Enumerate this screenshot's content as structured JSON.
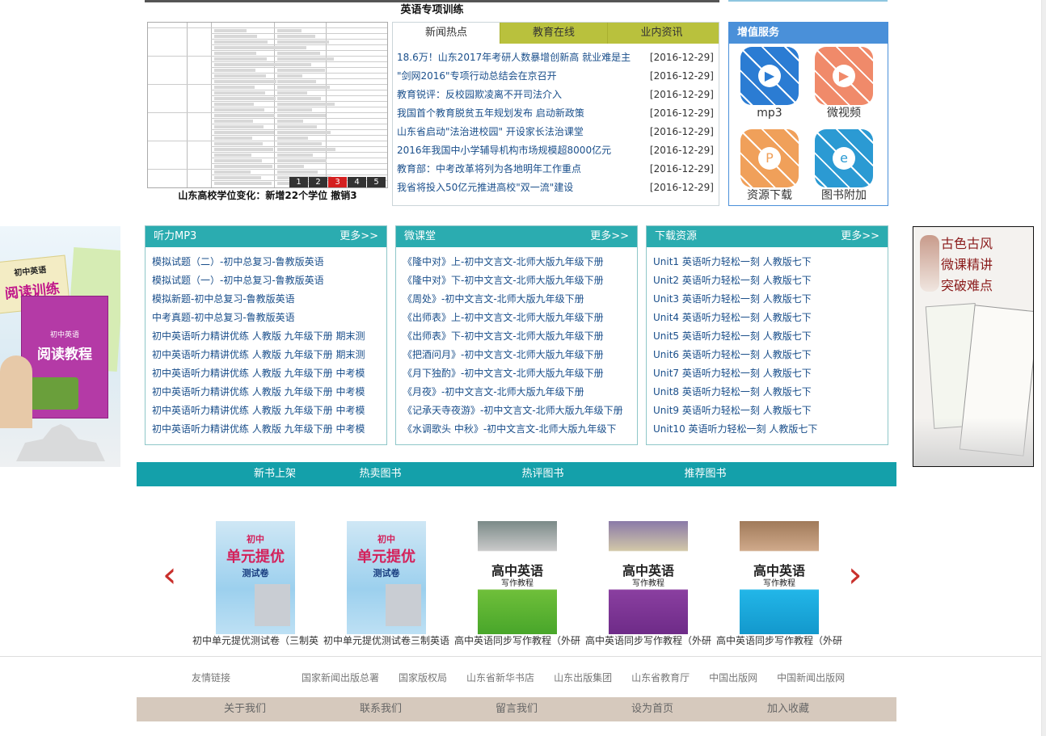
{
  "top_banner": {
    "title": "英语专项训练"
  },
  "slideshow": {
    "caption": "山东高校学位变化：新增22个学位  撤销3",
    "pages": [
      "1",
      "2",
      "3",
      "4",
      "5"
    ],
    "active_page": 3
  },
  "news": {
    "tabs": [
      "新闻热点",
      "教育在线",
      "业内资讯"
    ],
    "items": [
      {
        "title": "18.6万！山东2017年考研人数暴增创新高 就业难是主",
        "date": "[2016-12-29]"
      },
      {
        "title": "\"剑网2016\"专项行动总结会在京召开",
        "date": "[2016-12-29]"
      },
      {
        "title": "教育锐评：反校园欺凌离不开司法介入",
        "date": "[2016-12-29]"
      },
      {
        "title": "我国首个教育脱贫五年规划发布 启动新政策",
        "date": "[2016-12-29]"
      },
      {
        "title": "山东省启动\"法治进校园\" 开设家长法治课堂",
        "date": "[2016-12-29]"
      },
      {
        "title": "2016年我国中小学辅导机构市场规模超8000亿元",
        "date": "[2016-12-29]"
      },
      {
        "title": "教育部：中考改革将列为各地明年工作重点",
        "date": "[2016-12-29]"
      },
      {
        "title": "我省将投入50亿元推进高校\"双一流\"建设",
        "date": "[2016-12-29]"
      }
    ]
  },
  "services": {
    "title": "增值服务",
    "items": [
      {
        "label": "mp3",
        "icon": "play-icon",
        "color": "#2b7cd3"
      },
      {
        "label": "微视频",
        "icon": "video-icon",
        "color": "#f08a6a"
      },
      {
        "label": "资源下载",
        "icon": "ppt-icon",
        "color": "#f0a05a"
      },
      {
        "label": "图书附加",
        "icon": "ie-icon",
        "color": "#2b9ad3"
      }
    ]
  },
  "ads": {
    "left": {
      "line1": "初中英语",
      "line2": "阅读训练",
      "line3": "阅读教程",
      "line4": "初中英语"
    },
    "right": {
      "line1": "古色古风",
      "line2": "微课精讲",
      "line3": "突破难点"
    }
  },
  "panels": [
    {
      "title": "听力MP3",
      "more": "更多>>",
      "items": [
        "模拟试题（二）-初中总复习-鲁教版英语",
        "模拟试题（一）-初中总复习-鲁教版英语",
        "模拟新题-初中总复习-鲁教版英语",
        "中考真题-初中总复习-鲁教版英语",
        "初中英语听力精讲优练 人教版 九年级下册 期末测",
        "初中英语听力精讲优练 人教版 九年级下册 期末测",
        "初中英语听力精讲优练 人教版 九年级下册 中考模",
        "初中英语听力精讲优练 人教版 九年级下册 中考模",
        "初中英语听力精讲优练 人教版 九年级下册 中考模",
        "初中英语听力精讲优练 人教版 九年级下册 中考模"
      ]
    },
    {
      "title": "微课堂",
      "more": "更多>>",
      "items": [
        "《隆中对》上-初中文言文-北师大版九年级下册",
        "《隆中对》下-初中文言文-北师大版九年级下册",
        "《周处》-初中文言文-北师大版九年级下册",
        "《出师表》上-初中文言文-北师大版九年级下册",
        "《出师表》下-初中文言文-北师大版九年级下册",
        "《把酒问月》-初中文言文-北师大版九年级下册",
        "《月下独酌》-初中文言文-北师大版九年级下册",
        "《月夜》-初中文言文-北师大版九年级下册",
        "《记承天寺夜游》-初中文言文-北师大版九年级下册",
        "《水调歌头 中秋》-初中文言文-北师大版九年级下"
      ]
    },
    {
      "title": "下载资源",
      "more": "更多>>",
      "items": [
        "Unit1 英语听力轻松一刻 人教版七下",
        "Unit2 英语听力轻松一刻 人教版七下",
        "Unit3 英语听力轻松一刻 人教版七下",
        "Unit4 英语听力轻松一刻 人教版七下",
        "Unit5 英语听力轻松一刻 人教版七下",
        "Unit6 英语听力轻松一刻 人教版七下",
        "Unit7 英语听力轻松一刻 人教版七下",
        "Unit8 英语听力轻松一刻 人教版七下",
        "Unit9 英语听力轻松一刻 人教版七下",
        "Unit10 英语听力轻松一刻 人教版七下"
      ]
    }
  ],
  "book_tabs": [
    "新书上架",
    "热卖图书",
    "热评图书",
    "推荐图书"
  ],
  "books": [
    {
      "title": "初中单元提优测试卷（三制英",
      "cover_title": "单元提优",
      "cover_sub": "测试卷",
      "cover_top": "初中",
      "style": "tiyou"
    },
    {
      "title": "初中单元提优测试卷三制英语",
      "cover_title": "单元提优",
      "cover_sub": "测试卷",
      "cover_top": "初中",
      "style": "tiyou"
    },
    {
      "title": "高中英语同步写作教程（外研",
      "cover_title": "高中英语",
      "cover_sub": "写作教程",
      "cover_top": "",
      "style": "green"
    },
    {
      "title": "高中英语同步写作教程（外研",
      "cover_title": "高中英语",
      "cover_sub": "写作教程",
      "cover_top": "",
      "style": "purple"
    },
    {
      "title": "高中英语同步写作教程（外研",
      "cover_title": "高中英语",
      "cover_sub": "写作教程",
      "cover_top": "",
      "style": "cyan"
    }
  ],
  "carousel": {
    "prev": "‹",
    "next": "›"
  },
  "friends": {
    "label": "友情链接",
    "links": [
      "国家新闻出版总署",
      "国家版权局",
      "山东省新华书店",
      "山东出版集团",
      "山东省教育厅",
      "中国出版网",
      "中国新闻出版网"
    ]
  },
  "footer": [
    "关于我们",
    "联系我们",
    "留言我们",
    "设为首页",
    "加入收藏"
  ]
}
